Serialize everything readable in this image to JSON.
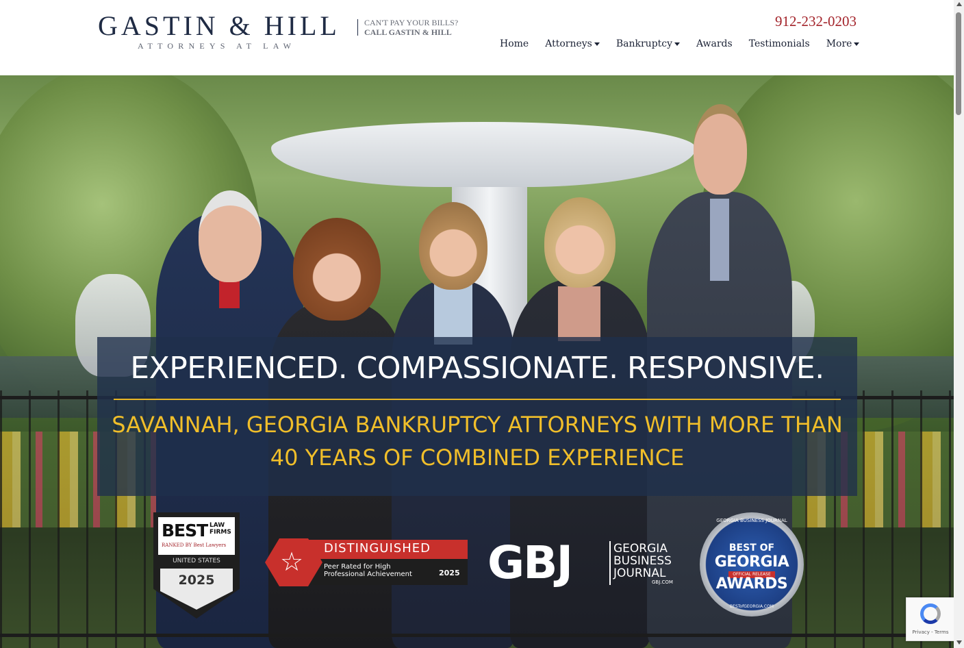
{
  "header": {
    "logo_main": "GASTIN & HILL",
    "logo_sub": "ATTORNEYS AT LAW",
    "tagline_line1": "CAN'T PAY YOUR BILLS?",
    "tagline_line2": "CALL GASTIN & HILL",
    "phone": "912-232-0203",
    "nav": [
      {
        "label": "Home",
        "has_caret": false
      },
      {
        "label": "Attorneys",
        "has_caret": true
      },
      {
        "label": "Bankruptcy",
        "has_caret": true
      },
      {
        "label": "Awards",
        "has_caret": false
      },
      {
        "label": "Testimonials",
        "has_caret": false
      },
      {
        "label": "More",
        "has_caret": true
      }
    ]
  },
  "hero": {
    "headline": "EXPERIENCED. COMPASSIONATE. RESPONSIVE.",
    "subheadline": "SAVANNAH, GEORGIA BANKRUPTCY ATTORNEYS WITH MORE THAN 40 YEARS OF COMBINED EXPERIENCE",
    "badges": {
      "best_law_firms": {
        "best": "BEST",
        "law_firms": "LAW FIRMS",
        "ranked_by": "RANKED BY Best Lawyers",
        "country": "UNITED STATES",
        "year": "2025"
      },
      "distinguished": {
        "title": "DISTINGUISHED",
        "subtitle": "Peer Rated for High Professional Achievement",
        "year": "2025"
      },
      "gbj": {
        "logo": "GBJ",
        "text": "GEORGIA BUSINESS JOURNAL",
        "url": "GBJ.COM"
      },
      "best_of_georgia": {
        "ring": "GEORGIA BUSINESS JOURNAL",
        "line1": "BEST OF",
        "line2": "GEORGIA",
        "ribbon": "OFFICIAL RELEASE",
        "line3": "AWARDS",
        "url": "BESTofGEORGIA.COM"
      }
    }
  },
  "recaptcha": {
    "text": "Privacy - Terms"
  },
  "colors": {
    "navy": "#1f2b44",
    "phone_red": "#a3232a",
    "gold": "#f0be2a",
    "banner_bg": "#1f304b"
  }
}
